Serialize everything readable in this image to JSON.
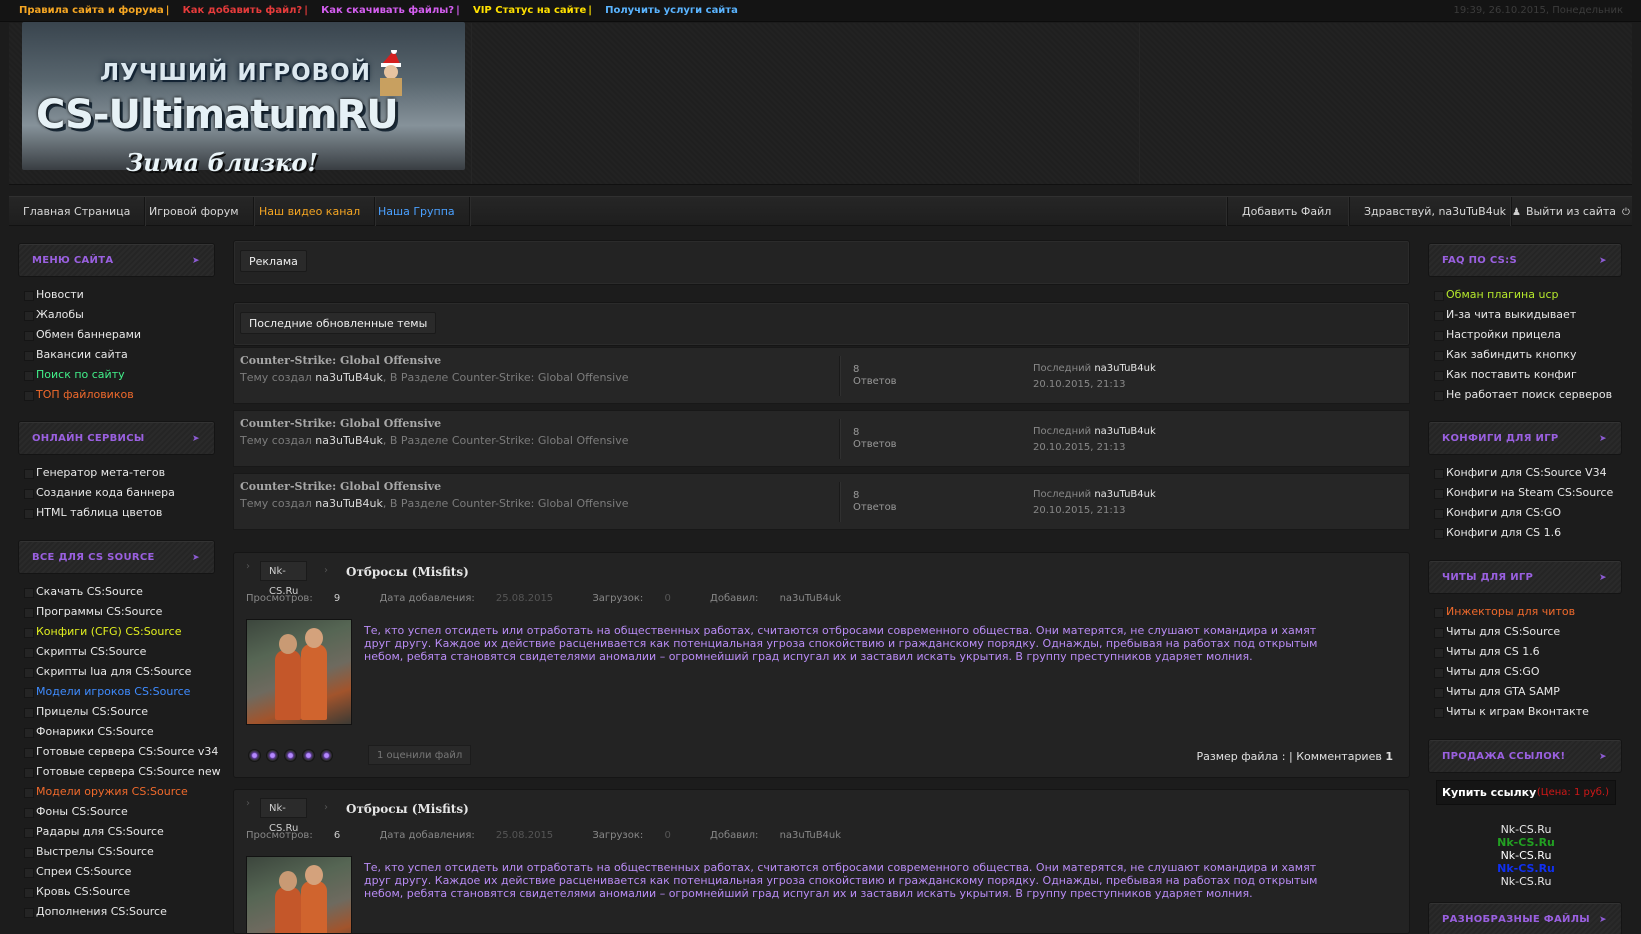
{
  "topbar": {
    "links": [
      {
        "label": "Правила сайта и форума",
        "color": "#f5a623"
      },
      {
        "label": "Как добавить файл?",
        "color": "#e53b3b"
      },
      {
        "label": "Как скачивать файлы?",
        "color": "#d45ef0"
      },
      {
        "label": "VIP Статус на сайте",
        "color": "#ffe000"
      },
      {
        "label": "Получить услуги сайта",
        "color": "#5ab4ff"
      }
    ],
    "datetime": "19:39, 26.10.2015, Понедельник"
  },
  "logo": {
    "top": "ЛУЧШИЙ ИГРОВОЙ",
    "main": "CS-UltimatumRU",
    "sub": "Зима близко!"
  },
  "nav": {
    "home": "Главная Страница",
    "forum": "Игровой форум",
    "video": "Наш видео канал",
    "group": "Наша Группа",
    "add_file": "Добавить Файл",
    "greeting": "Здравствуй, na3uTuB4uk",
    "logout": "Выйти из сайта"
  },
  "left": {
    "menu": {
      "title": "МЕНЮ САЙТА",
      "items": [
        "Новости",
        "Жалобы",
        "Обмен баннерами",
        "Вакансии сайта",
        "Поиск по сайту",
        "ТОП файловиков"
      ]
    },
    "online": {
      "title": "ОНЛАЙН СЕРВИСЫ",
      "items": [
        "Генератор мета-тегов",
        "Создание кода баннера",
        "HTML таблица цветов"
      ]
    },
    "cs": {
      "title": "ВСЕ ДЛЯ CS SOURCE",
      "items": [
        "Скачать CS:Source",
        "Программы CS:Source",
        "Конфиги (CFG) CS:Source",
        "Скрипты CS:Source",
        "Скрипты lua для CS:Source",
        "Модели игроков CS:Source",
        "Прицелы CS:Source",
        "Фонарики CS:Source",
        "Готовые сервера CS:Source v34",
        "Готовые сервера CS:Source new",
        "Модели оружия CS:Source",
        "Фоны CS:Source",
        "Радары для CS:Source",
        "Выстрелы CS:Source",
        "Спреи CS:Source",
        "Кровь CS:Source",
        "Дополнения CS:Source"
      ]
    }
  },
  "right": {
    "faq": {
      "title": "FAQ ПО CS:S",
      "items": [
        "Обман плагина ucp",
        "И-за чита выкидывает",
        "Настройки прицела",
        "Как забиндить кнопку",
        "Как поставить конфиг",
        "Не работает поиск серверов"
      ]
    },
    "configs": {
      "title": "КОНФИГИ ДЛЯ ИГР",
      "items": [
        "Конфиги для CS:Source V34",
        "Конфиги на Steam CS:Source",
        "Конфиги для CS:GO",
        "Конфиги для CS 1.6"
      ]
    },
    "cheats": {
      "title": "ЧИТЫ ДЛЯ ИГР",
      "items": [
        "Инжекторы для читов",
        "Читы для CS:Source",
        "Читы для CS 1.6",
        "Читы для CS:GO",
        "Читы для GTA SAMP",
        "Читы к играм Вконтакте"
      ]
    },
    "sale": {
      "title": "ПРОДАЖА ССЫЛОК!",
      "buy": "Купить ссылку",
      "price": "(Цена: 1 руб.)",
      "links": [
        "Nk-CS.Ru",
        "Nk-CS.Ru",
        "Nk-CS.Ru",
        "Nk-CS.Ru",
        "Nk-CS.Ru"
      ]
    },
    "misc": {
      "title": "РАЗНОБРАЗНЫЕ ФАЙЛЫ"
    }
  },
  "main": {
    "ad_label": "Реклама",
    "latest_label": "Последние обновленные темы",
    "topics": [
      {
        "title": "Counter-Strike: Global Offensive",
        "created_prefix": "Тему создал",
        "author": "na3uTuB4uk",
        "section": ", В Разделе Counter-Strike: Global Offensive",
        "count": "8",
        "replies": "Ответов",
        "last_prefix": "Последний",
        "last_user": "na3uTuB4uk",
        "date": "20.10.2015, 21:13"
      },
      {
        "title": "Counter-Strike: Global Offensive",
        "created_prefix": "Тему создал",
        "author": "na3uTuB4uk",
        "section": ", В Разделе Counter-Strike: Global Offensive",
        "count": "8",
        "replies": "Ответов",
        "last_prefix": "Последний",
        "last_user": "na3uTuB4uk",
        "date": "20.10.2015, 21:13"
      },
      {
        "title": "Counter-Strike: Global Offensive",
        "created_prefix": "Тему создал",
        "author": "na3uTuB4uk",
        "section": ", В Разделе Counter-Strike: Global Offensive",
        "count": "8",
        "replies": "Ответов",
        "last_prefix": "Последний",
        "last_user": "na3uTuB4uk",
        "date": "20.10.2015, 21:13"
      }
    ],
    "news": [
      {
        "source": "Nk-CS.Ru",
        "title": "Отбросы (Misfits)",
        "views_label": "Просмотров:",
        "views": "9",
        "date_label": "Дата добавления:",
        "date": "25.08.2015",
        "downloads_label": "Загрузок:",
        "downloads": "0",
        "added_label": "Добавил:",
        "added_by": "na3uTuB4uk",
        "text": "Те, кто успел отсидеть или отработать на общественных работах, считаются отбросами современного общества. Они матерятся, не слушают командира и хамят друг другу. Каждое их действие расценивается как потенциальная угроза спокойствию и гражданскому порядку. Однажды, пребывая на работах под открытым небом, ребята становятся свидетелями аномалии – огромнейший град испугал их и заставил искать укрытия. В группу преступников ударяет молния.",
        "rated": "1 оценили файл",
        "size": "Размер файла : | Комментариев",
        "comments": "1"
      },
      {
        "source": "Nk-CS.Ru",
        "title": "Отбросы (Misfits)",
        "views_label": "Просмотров:",
        "views": "6",
        "date_label": "Дата добавления:",
        "date": "25.08.2015",
        "downloads_label": "Загрузок:",
        "downloads": "0",
        "added_label": "Добавил:",
        "added_by": "na3uTuB4uk",
        "text": "Те, кто успел отсидеть или отработать на общественных работах, считаются отбросами современного общества. Они матерятся, не слушают командира и хамят друг другу. Каждое их действие расценивается как потенциальная угроза спокойствию и гражданскому порядку. Однажды, пребывая на работах под открытым небом, ребята становятся свидетелями аномалии – огромнейший град испугал их и заставил искать укрытия. В группу преступников ударяет молния."
      }
    ]
  },
  "colors": {
    "accent_purple": "#9a60e0",
    "news_text": "#b98cf5",
    "highlight_green": "#42f08a",
    "highlight_orange": "#f06a2c",
    "highlight_yellow": "#e2f020",
    "highlight_blue": "#3f8cff"
  }
}
